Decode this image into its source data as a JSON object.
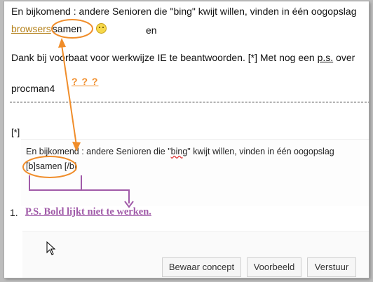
{
  "post": {
    "line1": "En bijkomend : andere Senioren die \"bing\" kwijt willen, vinden in één oogopslag",
    "browsers_link": "browsers",
    "samen": "samen",
    "en": "en",
    "line3_part1": "Dank bij voorbaat voor werkwijze IE te beantwoorden. [*] Met nog een",
    "ps_link": "p.s.",
    "line3_part2": "over",
    "author": "procman4",
    "question_marks": "? ? ?",
    "list_marker": "[*]"
  },
  "editor": {
    "line1_part1": "En bijkomend : andere Senioren die \"",
    "line1_wavy": "bing",
    "line1_part2": "\" kwijt willen, vinden in één oogopslag",
    "line2": "[b]samen  [/b]"
  },
  "list": {
    "number": "1.",
    "ps_title": "P.S. Bold lijkt niet te werken."
  },
  "buttons": {
    "draft": "Bewaar concept",
    "preview": "Voorbeeld",
    "submit": "Verstuur"
  },
  "colors": {
    "annotation_orange": "#f08d2a",
    "annotation_purple": "#a05aa8",
    "link_gold": "#b5821c"
  }
}
